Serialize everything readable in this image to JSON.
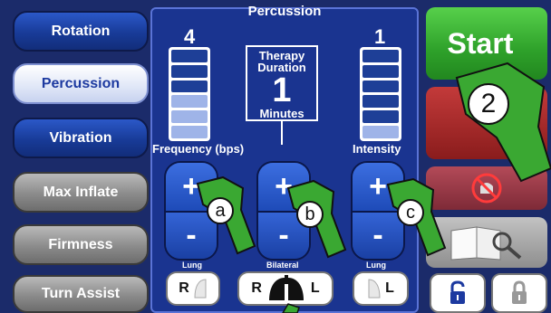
{
  "menu": [
    {
      "label": "Rotation",
      "style": "blue"
    },
    {
      "label": "Percussion",
      "style": "active"
    },
    {
      "label": "Vibration",
      "style": "blue"
    },
    {
      "label": "Max Inflate",
      "style": "gray"
    },
    {
      "label": "Firmness",
      "style": "gray"
    },
    {
      "label": "Turn Assist",
      "style": "gray"
    }
  ],
  "panel": {
    "title": "Percussion",
    "frequency": {
      "value": "4",
      "label": "Frequency (bps)",
      "level_fraction": 0.5
    },
    "duration": {
      "label": "Therapy Duration",
      "value": "1",
      "unit": "Minutes"
    },
    "intensity": {
      "value": "1",
      "label": "Intensity",
      "level_fraction": 0.17
    },
    "plus": "+",
    "minus": "-",
    "lung_left_label": "Lung",
    "bilateral_label": "Bilateral",
    "lung_right_label": "Lung",
    "lung_right_letter": "R",
    "bilateral_r": "R",
    "bilateral_l": "L",
    "lung_left_letter": "L"
  },
  "right": {
    "start_label": "Start"
  },
  "annotations": {
    "a": "a",
    "b": "b",
    "c": "c",
    "two": "2"
  },
  "colors": {
    "background": "#1b2b6a",
    "start": "#2ea12a",
    "arrow": "#3aa832"
  }
}
